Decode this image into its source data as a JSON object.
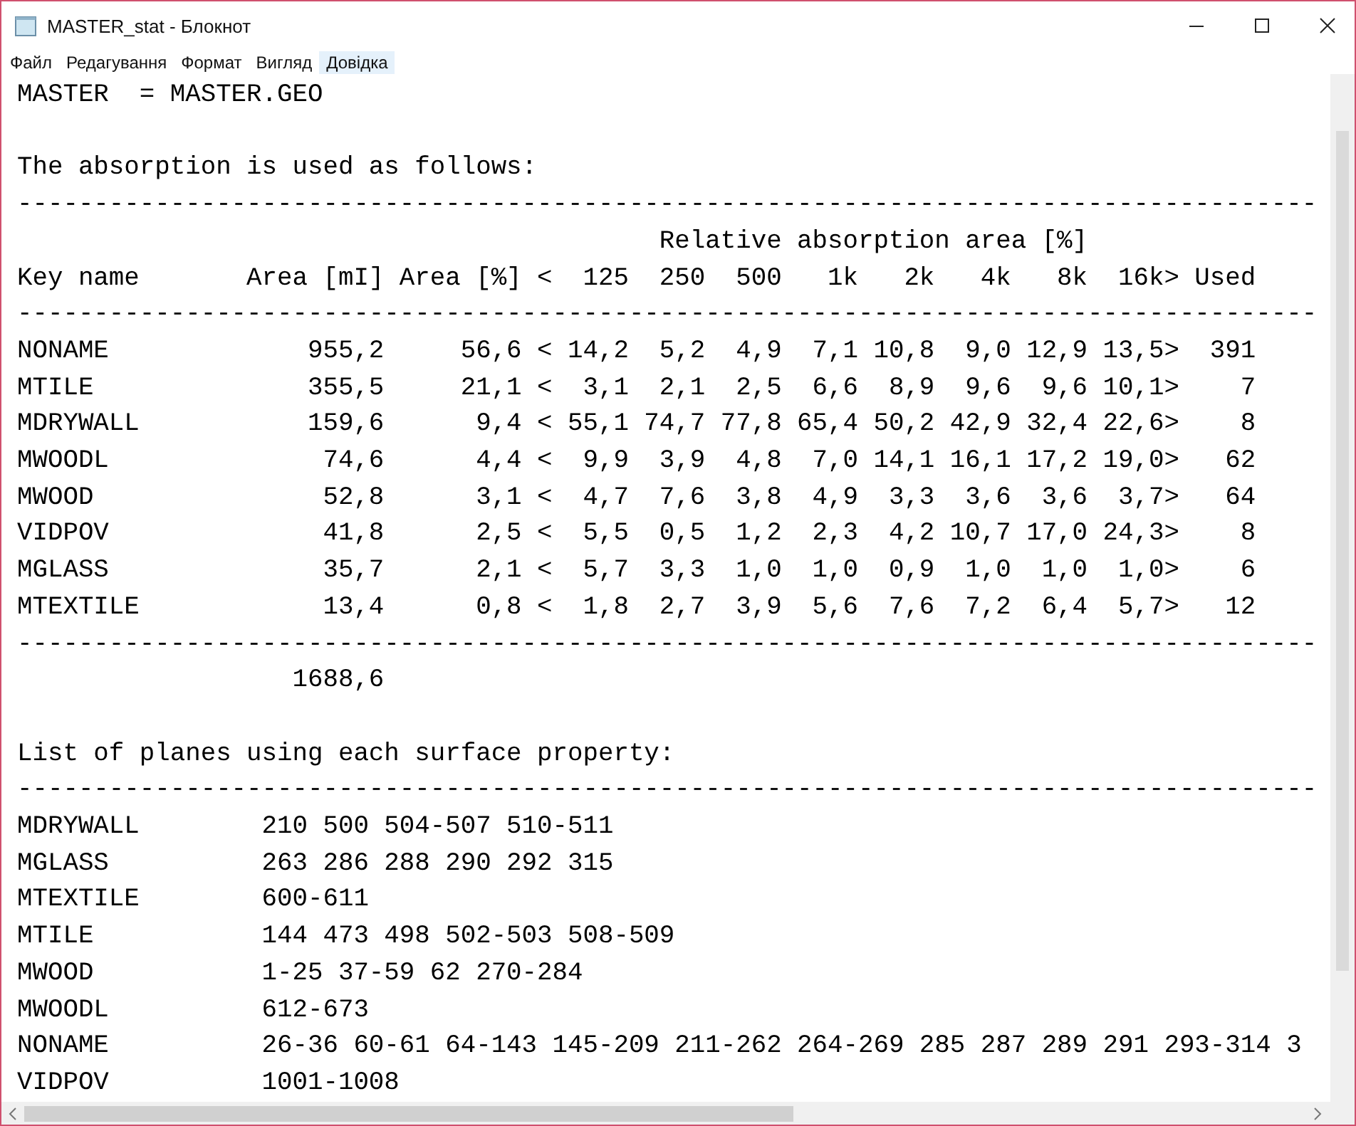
{
  "window": {
    "title": "MASTER_stat - Блокнот"
  },
  "menu": [
    {
      "label": "Файл",
      "selected": false
    },
    {
      "label": "Редагування",
      "selected": false
    },
    {
      "label": "Формат",
      "selected": false
    },
    {
      "label": "Вигляд",
      "selected": false
    },
    {
      "label": "Довідка",
      "selected": true
    }
  ],
  "document": {
    "blocks": [
      [
        "MASTER  = MASTER.GEO"
      ],
      [
        "The absorption is used as follows:",
        "-------------------------------------------------------------------------------------",
        "                                          Relative absorption area [%]",
        "Key name       Area [mI] Area [%] <  125  250  500   1k   2k   4k   8k  16k> Used",
        "-------------------------------------------------------------------------------------",
        "NONAME             955,2     56,6 < 14,2  5,2  4,9  7,1 10,8  9,0 12,9 13,5>  391",
        "MTILE              355,5     21,1 <  3,1  2,1  2,5  6,6  8,9  9,6  9,6 10,1>    7",
        "MDRYWALL           159,6      9,4 < 55,1 74,7 77,8 65,4 50,2 42,9 32,4 22,6>    8",
        "MWOODL              74,6      4,4 <  9,9  3,9  4,8  7,0 14,1 16,1 17,2 19,0>   62",
        "MWOOD               52,8      3,1 <  4,7  7,6  3,8  4,9  3,3  3,6  3,6  3,7>   64",
        "VIDPOV              41,8      2,5 <  5,5  0,5  1,2  2,3  4,2 10,7 17,0 24,3>    8",
        "MGLASS              35,7      2,1 <  5,7  3,3  1,0  1,0  0,9  1,0  1,0  1,0>    6",
        "MTEXTILE            13,4      0,8 <  1,8  2,7  3,9  5,6  7,6  7,2  6,4  5,7>   12",
        "-------------------------------------------------------------------------------------",
        "                  1688,6"
      ],
      [
        "List of planes using each surface property:",
        "-------------------------------------------------------------------------------------",
        "MDRYWALL        210 500 504-507 510-511",
        "MGLASS          263 286 288 290 292 315",
        "MTEXTILE        600-611",
        "MTILE           144 473 498 502-503 508-509",
        "MWOOD           1-25 37-59 62 270-284",
        "MWOODL          612-673",
        "NONAME          26-36 60-61 64-143 145-209 211-262 264-269 285 287 289 291 293-314 3",
        "VIDPOV          1001-1008"
      ]
    ]
  }
}
